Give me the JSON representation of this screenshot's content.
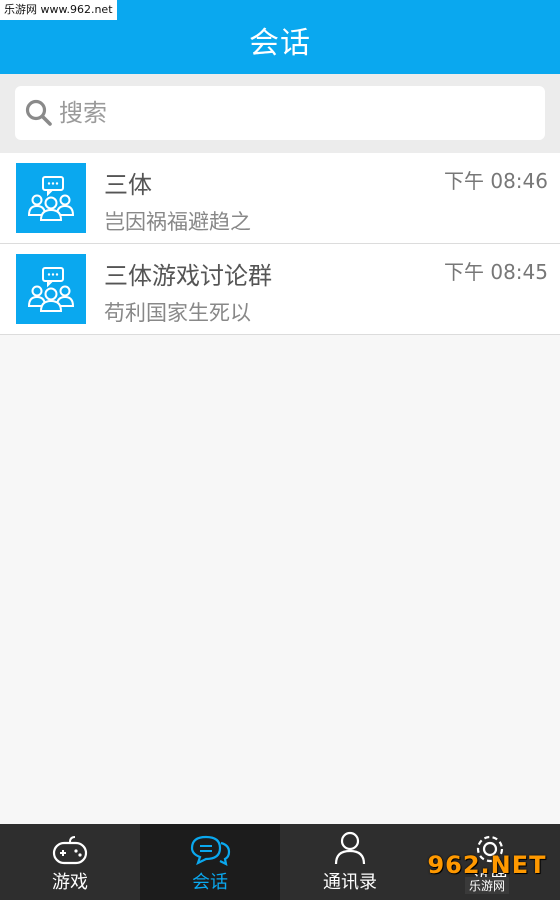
{
  "watermark": {
    "top": "乐游网 www.962.net",
    "bottom_logo": "962.NET",
    "bottom_sub": "乐游网"
  },
  "header": {
    "title": "会话"
  },
  "search": {
    "placeholder": "搜索"
  },
  "conversations": [
    {
      "name": "三体",
      "time": "下午 08:46",
      "preview": "岂因祸福避趋之"
    },
    {
      "name": "三体游戏讨论群",
      "time": "下午 08:45",
      "preview": "苟利国家生死以"
    }
  ],
  "tabs": [
    {
      "label": "游戏",
      "icon": "gamepad-icon",
      "active": false
    },
    {
      "label": "会话",
      "icon": "chat-bubbles-icon",
      "active": true
    },
    {
      "label": "通讯录",
      "icon": "contacts-person-icon",
      "active": false
    },
    {
      "label": "设置",
      "icon": "gear-icon",
      "active": false
    }
  ],
  "colors": {
    "accent": "#0aa8ef",
    "tabbar": "#2e2e2e"
  }
}
